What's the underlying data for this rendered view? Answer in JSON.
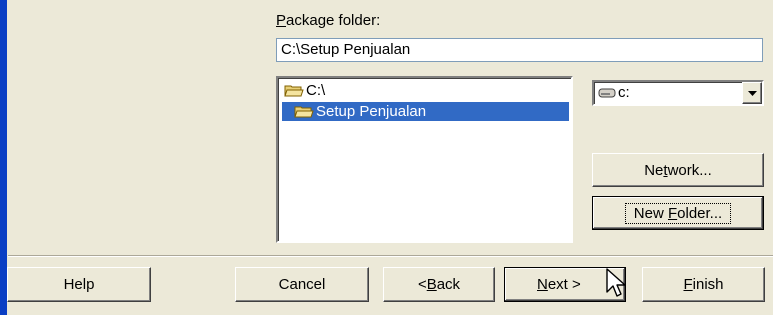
{
  "package_folder": {
    "label_mnemonic": "P",
    "label_rest": "ackage folder:",
    "value": "C:\\Setup Penjualan"
  },
  "folder_tree": {
    "items": [
      {
        "label": "C:\\",
        "selected": false,
        "icon": "open-folder-icon"
      },
      {
        "label": "Setup Penjualan",
        "selected": true,
        "icon": "open-folder-icon"
      }
    ]
  },
  "drive": {
    "value": "c:",
    "icon": "drive-icon"
  },
  "buttons": {
    "network": {
      "pre": "Ne",
      "mnemonic": "t",
      "post": "work..."
    },
    "new_folder": {
      "pre": "New ",
      "mnemonic": "F",
      "post": "older..."
    },
    "help": "Help",
    "cancel": "Cancel",
    "back": {
      "pre": "< ",
      "mnemonic": "B",
      "post": "ack"
    },
    "next": {
      "pre": "",
      "mnemonic": "N",
      "post": "ext >"
    },
    "finish": {
      "pre": "",
      "mnemonic": "F",
      "post": "inish"
    }
  },
  "colors": {
    "dialog_bg": "#ECE9D8",
    "selection": "#316AC5",
    "side_border": "#0A3FC4"
  }
}
